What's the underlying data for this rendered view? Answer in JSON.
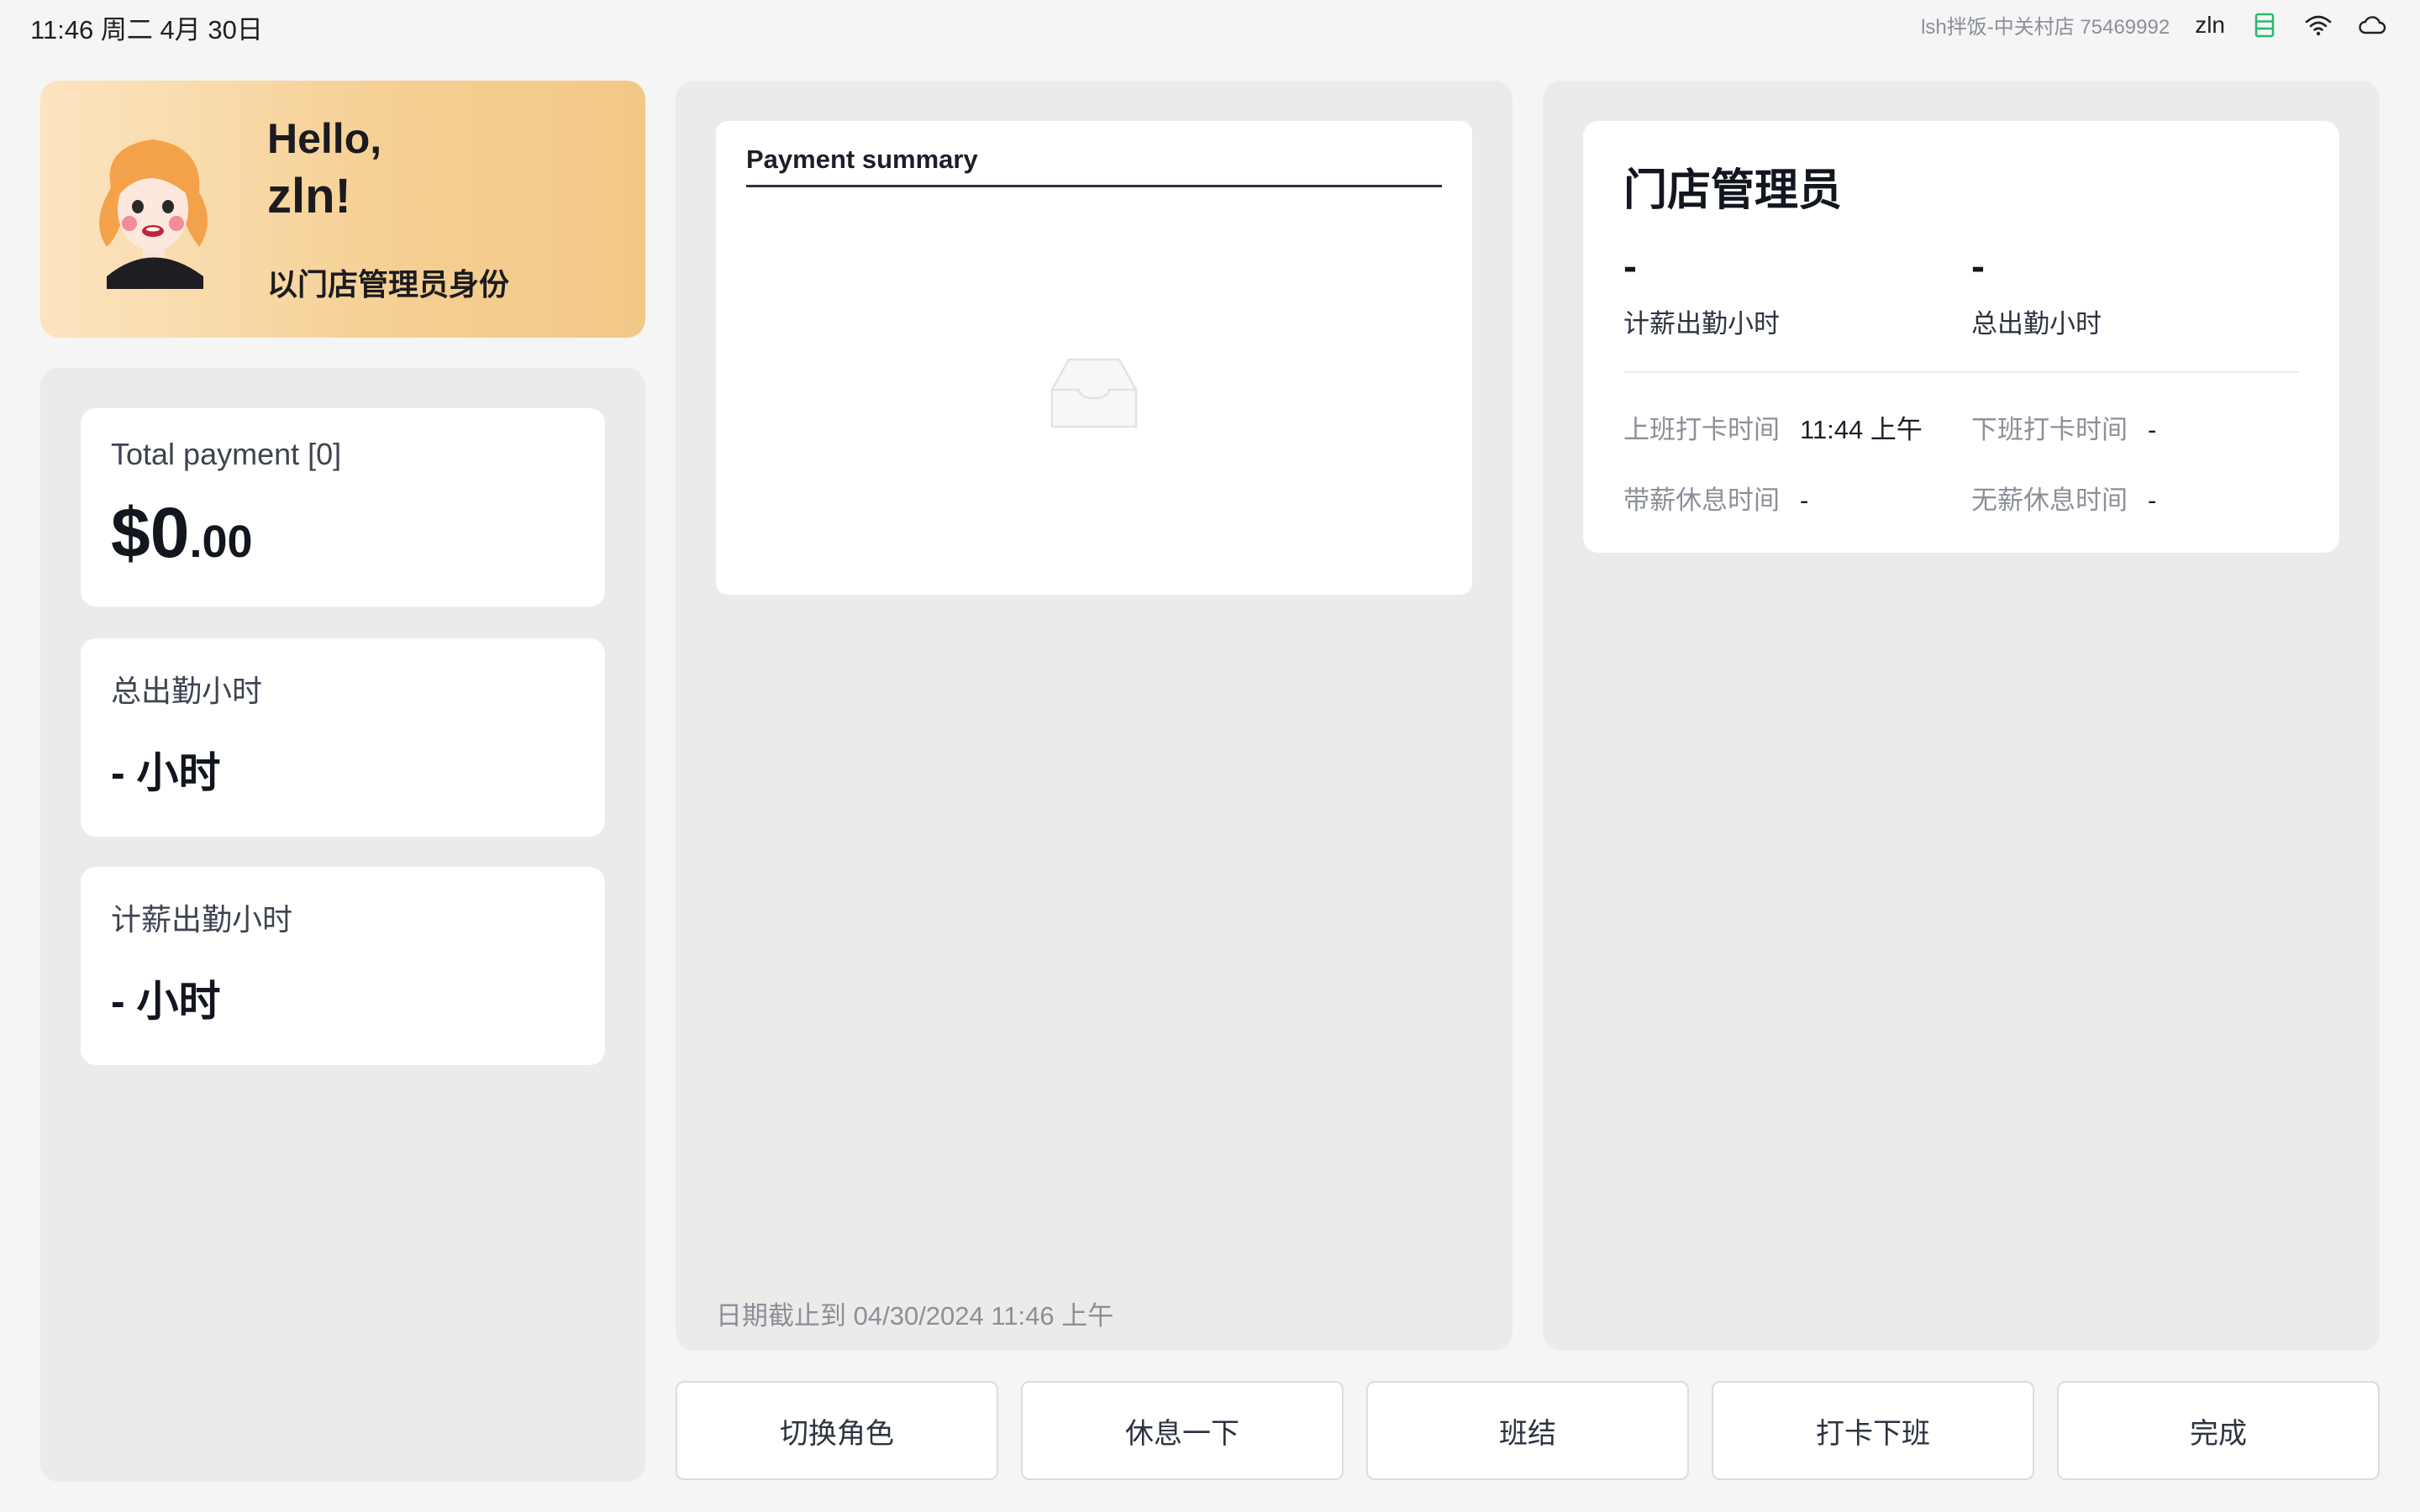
{
  "status_bar": {
    "datetime": "11:46 周二 4月 30日",
    "store": "lsh拌饭-中关村店  75469992",
    "user": "zln"
  },
  "hello_card": {
    "greeting": "Hello,",
    "name": "zln!",
    "role_line": "以门店管理员身份"
  },
  "stats": {
    "total_payment_label": "Total payment [0]",
    "total_payment_main": "$0",
    "total_payment_cents": ".00",
    "total_hours_label": "总出勤小时",
    "total_hours_value": "- 小时",
    "paid_hours_label": "计薪出勤小时",
    "paid_hours_value": "- 小时"
  },
  "payment_summary": {
    "tab_label": "Payment summary",
    "date_note": "日期截止到 04/30/2024 11:46 上午"
  },
  "role_card": {
    "title": "门店管理员",
    "paid_hours_value": "-",
    "paid_hours_label": "计薪出勤小时",
    "total_hours_value": "-",
    "total_hours_label": "总出勤小时",
    "clock_in_label": "上班打卡时间",
    "clock_in_value": "11:44 上午",
    "clock_out_label": "下班打卡时间",
    "clock_out_value": "-",
    "paid_break_label": "带薪休息时间",
    "paid_break_value": "-",
    "unpaid_break_label": "无薪休息时间",
    "unpaid_break_value": "-"
  },
  "actions": {
    "switch_role": "切换角色",
    "take_break": "休息一下",
    "shift_close": "班结",
    "clock_out": "打卡下班",
    "done": "完成"
  },
  "colors": {
    "hello_gradient_start": "#fce4c0",
    "hello_gradient_end": "#f2c886",
    "server_icon": "#2bb673"
  }
}
